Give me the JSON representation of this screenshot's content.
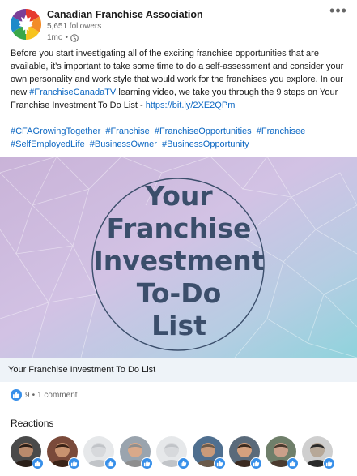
{
  "post": {
    "author": "Canadian Franchise Association",
    "followers": "5,651 followers",
    "time": "1mo",
    "dot": "•",
    "more_label": "•••",
    "body": {
      "line1": "Before you start investigating all of the exciting franchise opportunities that are available, it’s important to take some time to do a self-assessment and consider your own personality and work style that would work for the franchises you explore. In our new ",
      "hashtag_inline": "#FranchiseCanadaTV",
      "line2": " learning video, we take you through the 9 steps on Your Franchise Investment To Do List - ",
      "url": "https://bit.ly/2XE2QPm"
    },
    "hashtags": [
      "#CFAGrowingTogether",
      "#Franchise",
      "#FranchiseOpportunities",
      "#Franchisee",
      "#SelfEmployedLife",
      "#BusinessOwner",
      "#BusinessOpportunity"
    ]
  },
  "media": {
    "lines": [
      "Your",
      "Franchise",
      "Investment",
      "To-Do",
      "List"
    ],
    "caption": "Your Franchise Investment To Do List"
  },
  "social": {
    "likes": "9",
    "separator": "•",
    "comments": "1 comment"
  },
  "reactions": {
    "title": "Reactions",
    "avatars": [
      {
        "name": "reactor-1",
        "skin": "#b98a6c",
        "hair": "#2b1f18",
        "bg": "#4a4a4a"
      },
      {
        "name": "reactor-2",
        "skin": "#c8926f",
        "hair": "#3a2216",
        "bg": "#7a4a3a"
      },
      {
        "name": "reactor-3",
        "skin": "#d7d9dc",
        "hair": "#c1c4c8",
        "bg": "#e6e8ea"
      },
      {
        "name": "reactor-4",
        "skin": "#d9a98a",
        "hair": "#8e8e8e",
        "bg": "#9aa4ae"
      },
      {
        "name": "reactor-5",
        "skin": "#d7d9dc",
        "hair": "#c1c4c8",
        "bg": "#e6e8ea"
      },
      {
        "name": "reactor-6",
        "skin": "#c99a7a",
        "hair": "#6b5a4a",
        "bg": "#4f6f8f"
      },
      {
        "name": "reactor-7",
        "skin": "#d4a07e",
        "hair": "#3b2a1f",
        "bg": "#5a6a7a"
      },
      {
        "name": "reactor-8",
        "skin": "#caa08a",
        "hair": "#4a3a2e",
        "bg": "#6f7f6a"
      },
      {
        "name": "reactor-9",
        "skin": "#b7a898",
        "hair": "#2a2a2a",
        "bg": "#cfcfcf"
      }
    ]
  },
  "colors": {
    "link": "#0a66c2",
    "like": "#378fe9",
    "caption_bg": "#eef3f8",
    "media_text": "#3b4e6b"
  }
}
